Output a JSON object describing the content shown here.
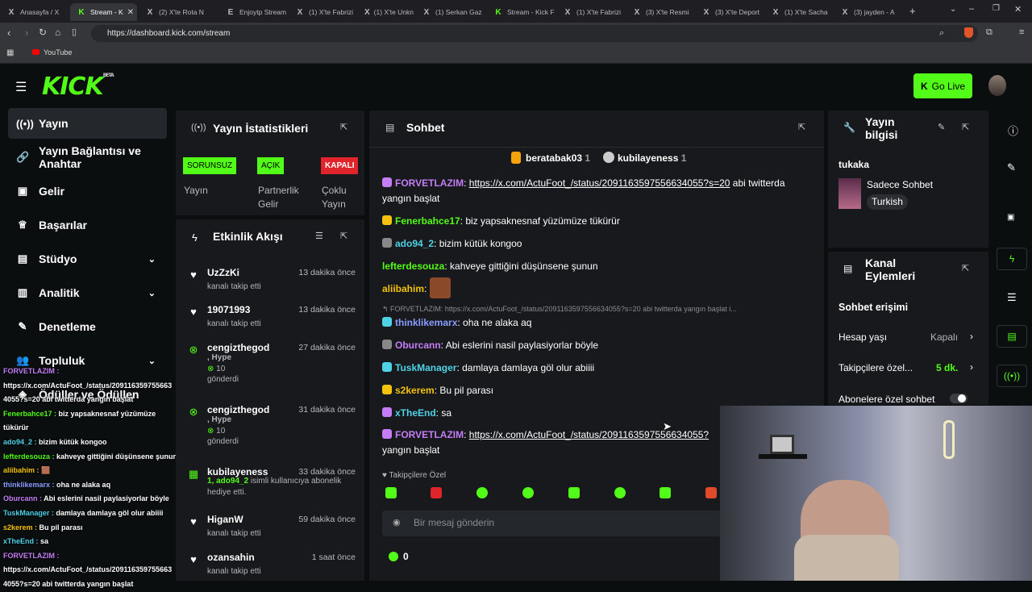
{
  "browser": {
    "tabs": [
      {
        "icon": "X",
        "label": "Anasayfa / X",
        "active": false
      },
      {
        "icon": "K",
        "label": "Stream - K",
        "active": true
      },
      {
        "icon": "X",
        "label": "(2) X'te Rota N",
        "active": false
      },
      {
        "icon": "E",
        "label": "Enjoytp Stream",
        "active": false
      },
      {
        "icon": "X",
        "label": "(1) X'te Fabrizi",
        "active": false
      },
      {
        "icon": "X",
        "label": "(1) X'te Unkno",
        "active": false
      },
      {
        "icon": "X",
        "label": "(1) Serkan Gaz",
        "active": false
      },
      {
        "icon": "K",
        "label": "Stream - Kick F",
        "active": false
      },
      {
        "icon": "X",
        "label": "(1) X'te Fabrizi",
        "active": false
      },
      {
        "icon": "X",
        "label": "(3) X'te Resmi",
        "active": false
      },
      {
        "icon": "X",
        "label": "(3) X'te Deport",
        "active": false
      },
      {
        "icon": "X",
        "label": "(1) X'te Sacha",
        "active": false
      },
      {
        "icon": "X",
        "label": "(3) jayden - A",
        "active": false
      }
    ],
    "url": "https://dashboard.kick.com/stream",
    "bookmark": "YouTube"
  },
  "header": {
    "logo": "KICK",
    "logo_sup": "BETA",
    "golive": "Go Live"
  },
  "sidebar": {
    "items": [
      {
        "label": "Yayın",
        "active": true
      },
      {
        "label": "Yayın Bağlantısı ve Anahtar",
        "active": false
      },
      {
        "label": "Gelir",
        "active": false
      },
      {
        "label": "Başarılar",
        "active": false
      },
      {
        "label": "Stüdyo",
        "active": false
      },
      {
        "label": "Analitik",
        "active": false
      },
      {
        "label": "Denetleme",
        "active": false
      },
      {
        "label": "Topluluk",
        "active": false
      },
      {
        "label": "Ödüller ve Ödüllen",
        "active": false
      }
    ]
  },
  "overlay": [
    {
      "u": "FORVETLAZIM :",
      "t": ""
    },
    {
      "u": "",
      "t": "https://x.com/ActuFoot_/status/209116359755663"
    },
    {
      "u": "",
      "t": "4055?s=20 abi twitterda yangın başlat"
    },
    {
      "u": "Fenerbahce17 :",
      "t": " biz yapsaknesnaf yüzümüze"
    },
    {
      "u": "",
      "t": "tükürür"
    },
    {
      "u": "ado94_2 :",
      "t": " bizim kütük kongoo"
    },
    {
      "u": "lefterdesouza :",
      "t": " kahveye gittiğini düşünsene şunun"
    },
    {
      "u": "aliibahim :",
      "t": " 🟫"
    },
    {
      "u": "thinklikemarx :",
      "t": " oha ne alaka aq"
    },
    {
      "u": "Oburcann :",
      "t": " Abi eslerini nasil paylasiyorlar böyle"
    },
    {
      "u": "TuskManager :",
      "t": " damlaya damlaya göl olur abiiii"
    },
    {
      "u": "s2kerem :",
      "t": " Bu pil parası"
    },
    {
      "u": "xTheEnd :",
      "t": " sa"
    },
    {
      "u": "FORVETLAZIM :",
      "t": ""
    },
    {
      "u": "",
      "t": "https://x.com/ActuFoot_/status/209116359755663"
    },
    {
      "u": "",
      "t": "4055?s=20 abi twitterda yangın başlat"
    }
  ],
  "stats": {
    "title": "Yayın İstatistikleri",
    "items": [
      {
        "badge": "SORUNSUZ",
        "label": "Yayın",
        "color": "#53fc18"
      },
      {
        "badge": "AÇIK",
        "label": "Partnerlik Gelir",
        "color": "#53fc18"
      },
      {
        "badge": "KAPALI",
        "label": "Çoklu Yayın",
        "color": "#e0242b"
      }
    ]
  },
  "activity": {
    "title": "Etkinlik Akışı",
    "items": [
      {
        "name": "UzZzKi",
        "time": "13 dakika önce",
        "sub": "kanalı takip etti",
        "type": "follow"
      },
      {
        "name": "19071993",
        "time": "13 dakika önce",
        "sub": "kanalı takip etti",
        "type": "follow"
      },
      {
        "name": "cengizthegod",
        "time": "27 dakika önce",
        "sub1": ", Hype",
        "sub2": "10",
        "sub3": "gönderdi",
        "type": "kick"
      },
      {
        "name": "cengizthegod",
        "time": "31 dakika önce",
        "sub1": ", Hype",
        "sub2": "10",
        "sub3": "gönderdi",
        "type": "kick"
      },
      {
        "name": "kubilayeness",
        "time": "33 dakika önce",
        "sub1": "1, ado94_2",
        "sub2": " isimli kullanıcıya abonelik hediye etti.",
        "type": "gift"
      },
      {
        "name": "HiganW",
        "time": "59 dakika önce",
        "sub": "kanalı takip etti",
        "type": "follow"
      },
      {
        "name": "ozansahin",
        "time": "1 saat önce",
        "sub": "kanalı takip etti",
        "type": "follow"
      }
    ]
  },
  "chat": {
    "title": "Sohbet",
    "top": [
      {
        "name": "beratabak03",
        "count": "1"
      },
      {
        "name": "kubilayeness",
        "count": "1"
      }
    ],
    "messages": [
      {
        "u": "FORVETLAZIM",
        "c": "#c47df7",
        "link": "https://x.com/ActuFoot_/status/2091163597556634055?s=20",
        "t": " abi twitterda yangın başlat"
      },
      {
        "u": "Fenerbahce17",
        "c": "#53fc18",
        "t": ": biz yapsaknesnaf yüzümüze tükürür"
      },
      {
        "u": "ado94_2",
        "c": "#4fd1e6",
        "t": ": bizim kütük kongoo"
      },
      {
        "u": "lefterdesouza",
        "c": "#53fc18",
        "t": ": kahveye gittiğini düşünsene şunun"
      },
      {
        "u": "aliibahim",
        "c": "#f4c20d",
        "t": ":"
      },
      {
        "u": "",
        "c": "#999",
        "t": "↰ FORVETLAZIM: https://x.com/ActuFoot_/status/2091163597556634055?s=20 abi twitterda yangın başlat i..."
      },
      {
        "u": "thinklikemarx",
        "c": "#8a9cff",
        "t": ": oha ne alaka aq"
      },
      {
        "u": "Oburcann",
        "c": "#c47df7",
        "t": ": Abi eslerini nasil paylasiyorlar böyle"
      },
      {
        "u": "TuskManager",
        "c": "#4fd1e6",
        "t": ": damlaya damlaya göl olur abiiii"
      },
      {
        "u": "s2kerem",
        "c": "#f4c20d",
        "t": ": Bu pil parası"
      },
      {
        "u": "xTheEnd",
        "c": "#4fd1e6",
        "t": ": sa"
      },
      {
        "u": "FORVETLAZIM",
        "c": "#c47df7",
        "link": "https://x.com/ActuFoot_/status/2091163597556634055?",
        "t": "yangın başlat"
      }
    ],
    "followers_only": "Takipçilere Özel",
    "placeholder": "Bir mesaj gönderin",
    "kicks": "0"
  },
  "streaminfo": {
    "title_line1": "Yayın",
    "title_line2": "bilgisi",
    "channel": "tukaka",
    "category": "Sadece Sohbet",
    "lang": "Turkish"
  },
  "channelactions": {
    "title_line1": "Kanal",
    "title_line2": "Eylemleri",
    "section": "Sohbet erişimi",
    "rows": [
      {
        "label": "Hesap yaşı",
        "value": "Kapalı"
      },
      {
        "label": "Takipçilere özel...",
        "value": "5 dk."
      },
      {
        "label": "Abonelere özel sohbet",
        "value": ""
      }
    ]
  }
}
